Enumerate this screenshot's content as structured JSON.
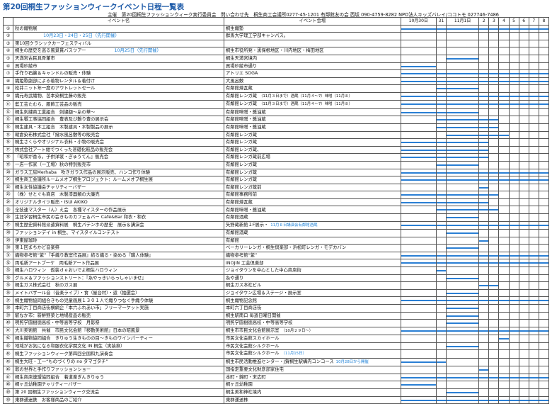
{
  "title": "第20回桐生ファッションウィークイベント日程一覧表",
  "subtitle": "主催　第20回桐生ファッションウィーク実行委員会　問い合わせ先　桐生商工会議所0277-45-1201 有鄰館友の会 西坂 090-4759-8282 NPO法人キッズバレイ/ココトモ 027746-7486",
  "headers": {
    "num": "",
    "event": "イベント名",
    "venue": "イベント会場"
  },
  "dates": [
    "10月30日",
    "31",
    "11月1日",
    "2",
    "3",
    "4",
    "5",
    "6",
    "7",
    "8"
  ],
  "rows": [
    {
      "n": "①",
      "event": "秋の織物展",
      "sub": "",
      "venue": "桐生織塾",
      "note": "",
      "bars": [
        [
          0,
          10
        ]
      ]
    },
    {
      "n": "②",
      "event": "",
      "sub": "10月23日・24日・25日（先行開催）",
      "venue": "群馬大学理工学部キャンパス。",
      "note": "",
      "bars": []
    },
    {
      "n": "③",
      "event": "第10回クラシックカーフェスティバル",
      "sub": "",
      "venue": "",
      "note": "",
      "bars": []
    },
    {
      "n": "④",
      "event": "桐生の歴史を巡る風景貫バスツアー",
      "sub": "10月25日（先行開催）",
      "venue": "桐生市役所発・黒保根地区・川内地区・梅田地区",
      "note": "",
      "bars": []
    },
    {
      "n": "⑤",
      "event": "天満宮古民具骨董市",
      "sub": "",
      "venue": "桐生天満宮境内",
      "note": "",
      "bars": [
        [
          2,
          3
        ]
      ]
    },
    {
      "n": "⑥",
      "event": "買場紗綾市",
      "sub": "",
      "venue": "買場紗綾市通り",
      "note": "",
      "bars": [
        [
          0,
          1
        ]
      ]
    },
    {
      "n": "⑦",
      "event": "手作り石鹸＆キャンドルの販売・体験",
      "sub": "",
      "venue": "アトリエ SOGA",
      "note": "",
      "bars": [
        [
          0,
          10
        ]
      ]
    },
    {
      "n": "⑧",
      "event": "織姫歌劇部による着物レンタル＆着付け",
      "sub": "",
      "venue": "大風呂敷",
      "note": "",
      "bars": [
        [
          0,
          10
        ]
      ]
    },
    {
      "n": "⑨",
      "event": "松井ニット年一度のアウトレットセール",
      "sub": "",
      "venue": "有鄰館煉瓦蔵",
      "note": "",
      "bars": [
        [
          1,
          3
        ]
      ]
    },
    {
      "n": "⑩",
      "event": "織元寿武織物、芭本染桐生藤の販売",
      "sub": "",
      "venue": "有鄰館レンガ蔵",
      "note": "（11月３日まで）酒蔵（11月４〜7）味噌（11月８）",
      "bars": [
        [
          0,
          10
        ]
      ]
    },
    {
      "n": "⑪",
      "event": "藍工芸たむら、服飾工芸品の販売",
      "sub": "",
      "venue": "有鄰館レンガ蔵",
      "note": "（11月３日まで）酒蔵（11月４〜7）味噌（11月８）",
      "bars": [
        [
          0,
          10
        ]
      ]
    },
    {
      "n": "⑫",
      "event": "桐生刺繍商工業組合　刺繍額〜糸の華〜",
      "sub": "",
      "venue": "有鄰館味噌・醤油蔵",
      "note": "",
      "bars": [
        [
          0,
          3
        ]
      ]
    },
    {
      "n": "⑬",
      "event": "桐生饗工事協同組合　豊表及び難り豊の展示会",
      "sub": "",
      "venue": "有鄰館味噌・醤油蔵",
      "note": "",
      "bars": [
        [
          1,
          5
        ]
      ]
    },
    {
      "n": "⑭",
      "event": "桐生建具・木工組合　木製建具・木製製品の展示",
      "sub": "",
      "venue": "有鄰館味噌・醤油蔵",
      "note": "",
      "bars": [
        [
          1,
          5
        ]
      ]
    },
    {
      "n": "⑮",
      "event": "朝倉染布株式会社「撥水風呂敷等の販売会",
      "sub": "",
      "venue": "有鄰館レンガ蔵",
      "note": "",
      "bars": [
        [
          2,
          6
        ]
      ]
    },
    {
      "n": "⑯",
      "event": "桐生さくらやオリジナル衣料・小物の販売会",
      "sub": "",
      "venue": "有鄰館レンガ蔵",
      "note": "",
      "bars": [
        [
          0,
          4
        ]
      ]
    },
    {
      "n": "⑰",
      "event": "株式会社アート紺でつくった甚礎化粧品の販売会",
      "sub": "",
      "venue": "有鄰館レンガ蔵、",
      "note": "",
      "bars": [
        [
          0,
          4
        ]
      ]
    },
    {
      "n": "⑱",
      "event": "『昭和が香る。子供洋裳・ぎゅうてん』販売会",
      "sub": "",
      "venue": "有鄰館レンガ蔵前広場",
      "note": "",
      "bars": [
        [
          0,
          4
        ]
      ]
    },
    {
      "n": "⑲",
      "event": "一店一作家（一工場）秋の特別販売市",
      "sub": "",
      "venue": "有鄰館レンガ蔵",
      "note": "",
      "bars": [
        [
          1,
          3
        ]
      ]
    },
    {
      "n": "⑳",
      "event": "ガラス工房Merhaba　吹きガラス作品の展示販売、ハンコ作り体験",
      "sub": "",
      "venue": "有鄰館レンガ蔵",
      "note": "",
      "bars": [
        [
          0,
          10
        ]
      ]
    },
    {
      "n": "㉑",
      "event": "桐生商工会議所ルームメオプ桐生プロジェクト：ルームメオプ桐生展",
      "sub": "",
      "venue": "有鄰館レンガ蔵",
      "note": "",
      "bars": [
        [
          0,
          10
        ]
      ]
    },
    {
      "n": "㉒",
      "event": "桐生女性協議会チャリティーバザー",
      "sub": "",
      "venue": "有鄰館レンガ蔵前",
      "note": "",
      "bars": [
        [
          3,
          4
        ]
      ]
    },
    {
      "n": "㉓",
      "event": "（株）せとぐも商店　木製漆器類の大廉売",
      "sub": "",
      "venue": "有鄰館事務所前",
      "note": "",
      "bars": [
        [
          0,
          5
        ]
      ]
    },
    {
      "n": "㉔",
      "event": "オリジナルタイツ販売・ISUI AKIKO",
      "sub": "",
      "venue": "有鄰館煉瓦蔵",
      "note": "",
      "bars": [
        [
          0,
          4
        ]
      ]
    },
    {
      "n": "㉕",
      "event": "全技連マスター〈ん〉え会　各種マイスターの作品展示",
      "sub": "",
      "venue": "有鄰館味噌・醤油蔵",
      "note": "",
      "bars": [
        [
          1,
          5
        ]
      ]
    },
    {
      "n": "㉖",
      "event": "生涯学習桐生市民の会きものカフェ＆バー Café&Bar 和衣・和衣",
      "sub": "",
      "venue": "有鄰館酒蔵",
      "note": "",
      "bars": [
        [
          2,
          3
        ]
      ]
    },
    {
      "n": "㉗",
      "event": "桐生歴史資料館派遣資料展　桐生パテンホの歴史　展示＆講演会",
      "sub": "",
      "venue": "矢野蔵新館１F展示・",
      "note": "11月８日講演会有鄰館酒蔵",
      "bars": [
        [
          0,
          10
        ]
      ]
    },
    {
      "n": "㉘",
      "event": "ファッションデイ in 桐生、マイスタイルコンテスト",
      "sub": "",
      "venue": "有鄰館酒蔵",
      "note": "",
      "bars": [
        [
          2,
          3
        ]
      ]
    },
    {
      "n": "㉙",
      "event": "伊東屋珈琲",
      "sub": "",
      "venue": "有鄰館",
      "note": "",
      "bars": [
        [
          3,
          4
        ]
      ]
    },
    {
      "n": "㉚",
      "event": "第１回まちかど音楽祭",
      "sub": "",
      "venue": "ベーカリーレンガ・桐生倶楽部・浜松町レンガ・モデカバン",
      "note": "",
      "bars": [
        [
          2,
          3
        ]
      ]
    },
    {
      "n": "㉛",
      "event": "織物参考館“紫”『手織り教室作品展』紡る織る・染める『職人体験』",
      "sub": "",
      "venue": "織物参考館“紫”",
      "note": "",
      "bars": [
        [
          0,
          10
        ]
      ]
    },
    {
      "n": "㉜",
      "event": "両毛新アートブーケ　両毛新アート作品展",
      "sub": "",
      "venue": "INOJIN 工芸倶楽部",
      "note": "",
      "bars": [
        [
          0,
          10
        ]
      ]
    },
    {
      "n": "㉝",
      "event": "桐生ハロウィン　仮装ｄｅおいでよ桐生ハロウィン",
      "sub": "",
      "venue": "ジョイタウンを中心とした中心商店街",
      "note": "",
      "bars": [
        [
          1,
          2
        ]
      ]
    },
    {
      "n": "㉞",
      "event": "グルメ＆ファッションストリート：『糸やっきいらっしゃいませ』",
      "sub": "",
      "venue": "糸や通り",
      "note": "",
      "bars": [
        [
          2,
          3
        ]
      ]
    },
    {
      "n": "㉟",
      "event": "桐生ガス株式会社　秋のガス展",
      "sub": "",
      "venue": "桐生ガス本社ビル",
      "note": "",
      "bars": [
        [
          3,
          5
        ]
      ]
    },
    {
      "n": "㊱",
      "event": "メイトバザール音（音楽ライブ）・食（屋台村）・遊（抽選会）",
      "sub": "",
      "venue": "ジョイタウン広場＆ステージ・展示室",
      "note": "",
      "bars": [
        [
          2,
          3
        ]
      ]
    },
    {
      "n": "㊲",
      "event": "桐生織物協同組合きもの児童画展１３０１人で織りつなぐ手織り体験",
      "sub": "",
      "venue": "桐生織物記念館",
      "note": "",
      "bars": [
        [
          0,
          10
        ]
      ]
    },
    {
      "n": "㊳",
      "event": "本町六丁目商店街横綱企「本六ふれあい市」フリーマーケット実施",
      "sub": "",
      "venue": "本町六丁目商店街",
      "note": "",
      "bars": [
        [
          2,
          3
        ]
      ]
    },
    {
      "n": "㊴",
      "event": "駅なか市：新鮮野菜と地場産品の販売",
      "sub": "",
      "venue": "桐生駅南口 毎週日曜日開催",
      "note": "",
      "bars": [
        [
          2,
          3
        ]
      ]
    },
    {
      "n": "㊵",
      "event": "明照学園樹徳高校・中等高等学校　月影祭",
      "sub": "",
      "venue": "明照学園樹徳高校・中等高等学校",
      "note": "",
      "bars": [
        [
          2,
          3
        ]
      ]
    },
    {
      "n": "㊶",
      "event": "大川美術館　共催　市民文化会館『移動美術館』日本の昭風景",
      "sub": "",
      "venue": "桐生市市民文化会館展示室",
      "note": "（10月２９日〜）",
      "bars": [
        [
          0,
          10
        ]
      ]
    },
    {
      "n": "㊷",
      "event": "桐生織物協同組合　きりゅう生きものの目〜きものワインパーティー",
      "sub": "",
      "venue": "市民文化会館スカイホール",
      "note": "",
      "bars": [
        [
          5,
          6
        ]
      ]
    },
    {
      "n": "㊸",
      "event": "地域がお気になる和服衣化学関文化 IN 桐生（実装祭）",
      "sub": "",
      "venue": "市民文化会館シルクホール",
      "note": "",
      "bars": [
        [
          2,
          3
        ]
      ]
    },
    {
      "n": "㊹",
      "event": "桐生ファッションウィーク第四回全国和九演奏会",
      "sub": "",
      "venue": "市民文化会館シルクホール",
      "note": "（11月15日）",
      "bars": []
    },
    {
      "n": "㊺",
      "event": "桐生大旺・工一“ものづくりの no タマゴタチ”",
      "sub": "",
      "venue": "桐生市民活動推進センター・J賀桐生駅構内コンコース",
      "note": "10月28日から開催",
      "bars": [
        [
          0,
          2
        ]
      ]
    },
    {
      "n": "㊻",
      "event": "歌の世界と手作りファッションショー",
      "sub": "",
      "venue": "国指定重要文化財彦部家住宅",
      "note": "",
      "bars": [
        [
          3,
          4
        ]
      ]
    },
    {
      "n": "㊼",
      "event": "桐生商店連盟協同組合　着道楽ぎんきりゅう",
      "sub": "",
      "venue": "本町・錦町・末広町",
      "note": "",
      "bars": [
        [
          0,
          10
        ]
      ]
    },
    {
      "n": "㊽",
      "event": "桐ヶ丘幼稚園チャリティーバザー",
      "sub": "",
      "venue": "桐ヶ丘幼稚園",
      "note": "",
      "bars": [
        [
          0,
          1
        ]
      ]
    },
    {
      "n": "㊾",
      "event": "第 20 回桐生ファッションウィーク交流会",
      "sub": "",
      "venue": "桐生美和神社境内",
      "note": "",
      "bars": [
        [
          2,
          3
        ]
      ]
    },
    {
      "n": "㊿",
      "event": "東群通迷鉄　お客様商品のご紹介",
      "sub": "",
      "venue": "東群運送株",
      "note": "",
      "bars": [
        [
          0,
          10
        ]
      ]
    }
  ],
  "colors": {
    "title": "#1d5aa8",
    "bar": "#2a7fd4",
    "accent_text": "#1a7fd6"
  }
}
